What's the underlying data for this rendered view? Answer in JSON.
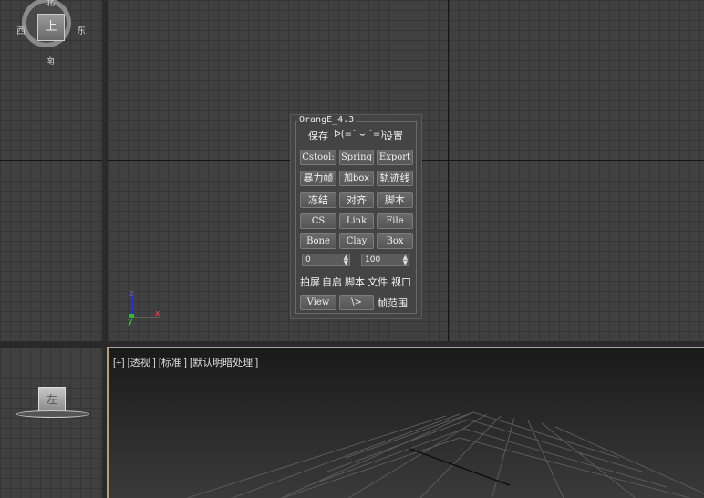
{
  "viewports": {
    "top_left_cube": {
      "face": "上",
      "north": "北",
      "south": "南",
      "west": "西",
      "east": "东"
    },
    "front_cube": {
      "face": "左"
    },
    "perspective": {
      "label": "[+] [透视 ] [标准 ] [默认明暗处理 ]"
    },
    "gizmo": {
      "x": "x",
      "y": "y",
      "z": "z"
    }
  },
  "panel": {
    "title": "OrangE_4.3",
    "top_row": {
      "save": "保存",
      "face": "ᐅ(=˘ ⌣ ˘=) ",
      "settings": "设置"
    },
    "rows": [
      [
        "Cstool:",
        "Spring",
        "Export"
      ],
      [
        "暴力帧",
        "加box",
        "轨迹线"
      ],
      [
        "冻结",
        "对齐",
        "脚本"
      ],
      [
        "CS",
        "Link",
        "File"
      ],
      [
        "Bone",
        "Clay",
        "Box"
      ]
    ],
    "spinner_start": "0",
    "spinner_end": "100",
    "text_row": [
      "拍屏",
      "自启",
      "脚本",
      "文件",
      "视口"
    ],
    "last_row": {
      "view": "View",
      "slash": "\\>",
      "frame_range": "帧范围"
    }
  }
}
